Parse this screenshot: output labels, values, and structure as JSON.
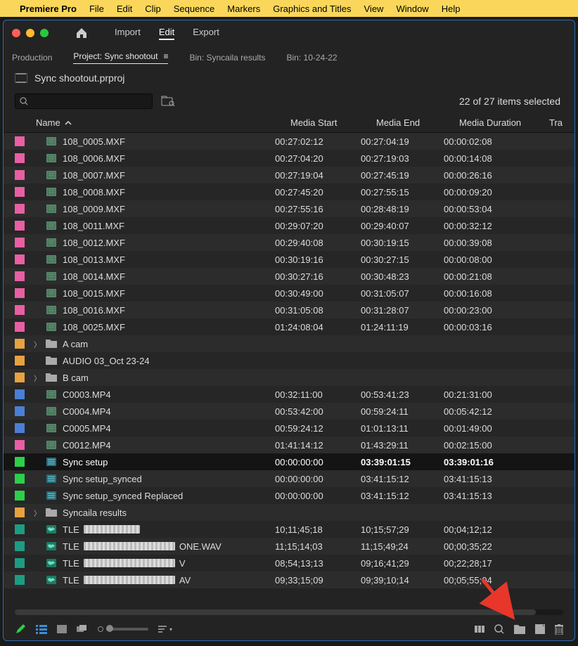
{
  "menubar": {
    "appname": "Premiere Pro",
    "items": [
      "File",
      "Edit",
      "Clip",
      "Sequence",
      "Markers",
      "Graphics and Titles",
      "View",
      "Window",
      "Help"
    ]
  },
  "topnav": {
    "items": [
      "Import",
      "Edit",
      "Export"
    ],
    "active": 1
  },
  "tabs": [
    "Production",
    "Project: Sync shootout",
    "Bin: Syncaila results",
    "Bin: 10-24-22"
  ],
  "tabs_active": 1,
  "project_file": "Sync shootout.prproj",
  "selection_text": "22 of 27 items selected",
  "columns": {
    "name": "Name",
    "start": "Media Start",
    "end": "Media End",
    "dur": "Media Duration",
    "tra": "Tra"
  },
  "label_colors": {
    "pink": "#e85fa3",
    "orange": "#e8a23f",
    "blue": "#4a7fd6",
    "green": "#2bcf4a",
    "dkgreen": "#1d9c83"
  },
  "rows": [
    {
      "label": "pink",
      "type": "clip",
      "name": "108_0005.MXF",
      "start": "00:27:02:12",
      "end": "00:27:04:19",
      "dur": "00:00:02:08"
    },
    {
      "label": "pink",
      "type": "clip",
      "name": "108_0006.MXF",
      "start": "00:27:04:20",
      "end": "00:27:19:03",
      "dur": "00:00:14:08"
    },
    {
      "label": "pink",
      "type": "clip",
      "name": "108_0007.MXF",
      "start": "00:27:19:04",
      "end": "00:27:45:19",
      "dur": "00:00:26:16"
    },
    {
      "label": "pink",
      "type": "clip",
      "name": "108_0008.MXF",
      "start": "00:27:45:20",
      "end": "00:27:55:15",
      "dur": "00:00:09:20"
    },
    {
      "label": "pink",
      "type": "clip",
      "name": "108_0009.MXF",
      "start": "00:27:55:16",
      "end": "00:28:48:19",
      "dur": "00:00:53:04"
    },
    {
      "label": "pink",
      "type": "clip",
      "name": "108_0011.MXF",
      "start": "00:29:07:20",
      "end": "00:29:40:07",
      "dur": "00:00:32:12"
    },
    {
      "label": "pink",
      "type": "clip",
      "name": "108_0012.MXF",
      "start": "00:29:40:08",
      "end": "00:30:19:15",
      "dur": "00:00:39:08"
    },
    {
      "label": "pink",
      "type": "clip",
      "name": "108_0013.MXF",
      "start": "00:30:19:16",
      "end": "00:30:27:15",
      "dur": "00:00:08:00"
    },
    {
      "label": "pink",
      "type": "clip",
      "name": "108_0014.MXF",
      "start": "00:30:27:16",
      "end": "00:30:48:23",
      "dur": "00:00:21:08"
    },
    {
      "label": "pink",
      "type": "clip",
      "name": "108_0015.MXF",
      "start": "00:30:49:00",
      "end": "00:31:05:07",
      "dur": "00:00:16:08"
    },
    {
      "label": "pink",
      "type": "clip",
      "name": "108_0016.MXF",
      "start": "00:31:05:08",
      "end": "00:31:28:07",
      "dur": "00:00:23:00"
    },
    {
      "label": "pink",
      "type": "clip",
      "name": "108_0025.MXF",
      "start": "01:24:08:04",
      "end": "01:24:11:19",
      "dur": "00:00:03:16"
    },
    {
      "label": "orange",
      "type": "bin",
      "name": "A cam",
      "exp": true
    },
    {
      "label": "orange",
      "type": "bin",
      "name": "AUDIO 03_Oct 23-24"
    },
    {
      "label": "orange",
      "type": "bin",
      "name": "B cam",
      "exp": true
    },
    {
      "label": "blue",
      "type": "clip",
      "name": "C0003.MP4",
      "start": "00:32:11:00",
      "end": "00:53:41:23",
      "dur": "00:21:31:00"
    },
    {
      "label": "blue",
      "type": "clip",
      "name": "C0004.MP4",
      "start": "00:53:42:00",
      "end": "00:59:24:11",
      "dur": "00:05:42:12"
    },
    {
      "label": "blue",
      "type": "clip",
      "name": "C0005.MP4",
      "start": "00:59:24:12",
      "end": "01:01:13:11",
      "dur": "00:01:49:00"
    },
    {
      "label": "pink",
      "type": "clip",
      "name": "C0012.MP4",
      "start": "01:41:14:12",
      "end": "01:43:29:11",
      "dur": "00:02:15:00"
    },
    {
      "label": "green",
      "type": "seq",
      "name": "Sync setup",
      "start": "00:00:00:00",
      "end": "03:39:01:15",
      "dur": "03:39:01:16",
      "seq": true
    },
    {
      "label": "green",
      "type": "seq",
      "name": "Sync setup_synced",
      "start": "00:00:00:00",
      "end": "03:41:15:12",
      "dur": "03:41:15:13"
    },
    {
      "label": "green",
      "type": "seq",
      "name": "Sync setup_synced Replaced",
      "start": "00:00:00:00",
      "end": "03:41:15:12",
      "dur": "03:41:15:13"
    },
    {
      "label": "orange",
      "type": "bin",
      "name": "Syncaila results",
      "exp": true
    },
    {
      "label": "dkgreen",
      "type": "audio",
      "name": "TLE",
      "redact": [
        80
      ],
      "start": "10;11;45;18",
      "end": "10;15;57;29",
      "dur": "00;04;12;12"
    },
    {
      "label": "dkgreen",
      "type": "audio",
      "name": "TLE",
      "redact": [
        130
      ],
      "suffix": "ONE.WAV",
      "start": "11;15;14;03",
      "end": "11;15;49;24",
      "dur": "00;00;35;22"
    },
    {
      "label": "dkgreen",
      "type": "audio",
      "name": "TLE",
      "redact": [
        130
      ],
      "suffix": "V",
      "start": "08;54;13;13",
      "end": "09;16;41;29",
      "dur": "00;22;28;17"
    },
    {
      "label": "dkgreen",
      "type": "audio",
      "name": "TLE",
      "redact": [
        130
      ],
      "suffix": "AV",
      "start": "09;33;15;09",
      "end": "09;39;10;14",
      "dur": "00;05;55;04"
    }
  ]
}
